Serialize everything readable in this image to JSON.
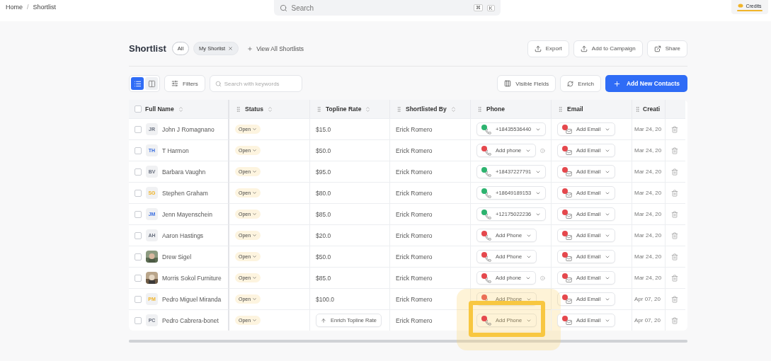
{
  "breadcrumb": [
    "Home",
    "Shortlist"
  ],
  "breadcrumb_separator": "/",
  "select_all_checked": false,
  "search": {
    "placeholder": "Search",
    "keys": [
      "⌘",
      "K"
    ]
  },
  "credits": {
    "label": "Credits"
  },
  "title": "Shortlist",
  "filters": [
    {
      "label": "All",
      "kind": "pill",
      "selected": false
    },
    {
      "label": "My Shorlist",
      "kind": "chip",
      "selected": true
    },
    {
      "label": "View All Shortlists",
      "kind": "link"
    }
  ],
  "actions": [
    "Export",
    "Add to Campaign",
    "Share"
  ],
  "views": [
    {
      "kind": "list",
      "selected": true
    },
    {
      "kind": "board",
      "selected": false
    }
  ],
  "filters_button": "Filters",
  "keyword_search": {
    "placeholder": "Search with keywords"
  },
  "toolbar_right": {
    "visible_fields": "Visible Fields",
    "enrich": "Enrich",
    "add": "Add New Contacts"
  },
  "columns": [
    {
      "label": "Full Name",
      "sortable": true,
      "handle": false
    },
    {
      "label": "Status",
      "sortable": true,
      "handle": true
    },
    {
      "label": "Topline Rate",
      "sortable": true,
      "handle": true
    },
    {
      "label": "Shortlisted By",
      "sortable": true,
      "handle": true
    },
    {
      "label": "Phone",
      "sortable": false,
      "handle": true
    },
    {
      "label": "Email",
      "sortable": false,
      "handle": true
    },
    {
      "label": "Creati",
      "sortable": false,
      "handle": true
    }
  ],
  "rows": [
    {
      "avatar": {
        "kind": "initials",
        "initials": "JR",
        "color": "#6b7280"
      },
      "name": "John J Romagnano",
      "status": "Open",
      "rate": {
        "kind": "value",
        "text": "$15.0"
      },
      "by": "Erick Romero",
      "phone": {
        "verified": true,
        "text": "+18435536440",
        "info": false
      },
      "email": {
        "verified": false,
        "text": "Add Email"
      },
      "created": "Mar 24, 20",
      "highlighted": false,
      "checked": false
    },
    {
      "avatar": {
        "kind": "initials",
        "initials": "TH",
        "color": "#3b6fe0"
      },
      "name": "T Harmon",
      "status": "Open",
      "rate": {
        "kind": "value",
        "text": "$50.0"
      },
      "by": "Erick Romero",
      "phone": {
        "verified": false,
        "text": "Add phone",
        "info": true
      },
      "email": {
        "verified": false,
        "text": "Add Email"
      },
      "created": "Mar 24, 20",
      "highlighted": false,
      "checked": false
    },
    {
      "avatar": {
        "kind": "initials",
        "initials": "BV",
        "color": "#6b7280"
      },
      "name": "Barbara Vaughn",
      "status": "Open",
      "rate": {
        "kind": "value",
        "text": "$95.0"
      },
      "by": "Erick Romero",
      "phone": {
        "verified": true,
        "text": "+18437227791",
        "info": false
      },
      "email": {
        "verified": false,
        "text": "Add Email"
      },
      "created": "Mar 24, 20",
      "highlighted": false,
      "checked": false
    },
    {
      "avatar": {
        "kind": "initials",
        "initials": "SG",
        "color": "#f0b429"
      },
      "name": "Stephen Graham",
      "status": "Open",
      "rate": {
        "kind": "value",
        "text": "$80.0"
      },
      "by": "Erick Romero",
      "phone": {
        "verified": true,
        "text": "+18649189153",
        "info": false
      },
      "email": {
        "verified": false,
        "text": "Add Email"
      },
      "created": "Mar 24, 20",
      "highlighted": false,
      "checked": false
    },
    {
      "avatar": {
        "kind": "initials",
        "initials": "JM",
        "color": "#3b6fe0"
      },
      "name": "Jenn Mayenschein",
      "status": "Open",
      "rate": {
        "kind": "value",
        "text": "$85.0"
      },
      "by": "Erick Romero",
      "phone": {
        "verified": true,
        "text": "+12175022236",
        "info": false
      },
      "email": {
        "verified": false,
        "text": "Add Email"
      },
      "created": "Mar 24, 20",
      "highlighted": false,
      "checked": false
    },
    {
      "avatar": {
        "kind": "initials",
        "initials": "AH",
        "color": "#6b7280"
      },
      "name": "Aaron Hastings",
      "status": "Open",
      "rate": {
        "kind": "value",
        "text": "$20.0"
      },
      "by": "Erick Romero",
      "phone": {
        "verified": false,
        "text": "Add Phone",
        "info": false
      },
      "email": {
        "verified": false,
        "text": "Add Email"
      },
      "created": "Mar 24, 20",
      "highlighted": false,
      "checked": false
    },
    {
      "name": "Drew Sigel",
      "status": "Open",
      "rate": {
        "kind": "value",
        "text": "$50.0"
      },
      "by": "Erick Romero",
      "phone": {
        "verified": false,
        "text": "Add Phone",
        "info": false
      },
      "email": {
        "verified": false,
        "text": "Add Email"
      },
      "created": "Mar 24, 20",
      "highlighted": false,
      "checked": false
    },
    {
      "name": "Morris Sokol Furniture",
      "status": "Open",
      "rate": {
        "kind": "value",
        "text": "$85.0"
      },
      "by": "Erick Romero",
      "phone": {
        "verified": false,
        "text": "Add phone",
        "info": true
      },
      "email": {
        "verified": false,
        "text": "Add Email"
      },
      "created": "Mar 24, 20",
      "highlighted": false,
      "checked": false
    },
    {
      "avatar": {
        "kind": "initials",
        "initials": "PM",
        "color": "#f0b429"
      },
      "name": "Pedro Miguel Miranda",
      "status": "Open",
      "rate": {
        "kind": "value",
        "text": "$100.0"
      },
      "by": "Erick Romero",
      "phone": {
        "verified": false,
        "text": "Add Phone",
        "info": false
      },
      "email": {
        "verified": false,
        "text": "Add Email"
      },
      "created": "Apr 07, 20",
      "highlighted": false,
      "checked": false
    },
    {
      "avatar": {
        "kind": "initials",
        "initials": "PC",
        "color": "#6b7280"
      },
      "name": "Pedro Cabrera-bonet",
      "status": "Open",
      "rate": {
        "kind": "button",
        "text": "Enrich Topline Rate"
      },
      "by": "Erick Romero",
      "phone": {
        "verified": false,
        "text": "Add Phone",
        "info": false
      },
      "email": {
        "verified": false,
        "text": "Add Email"
      },
      "created": "Apr 07, 20",
      "highlighted": true,
      "checked": false
    }
  ]
}
